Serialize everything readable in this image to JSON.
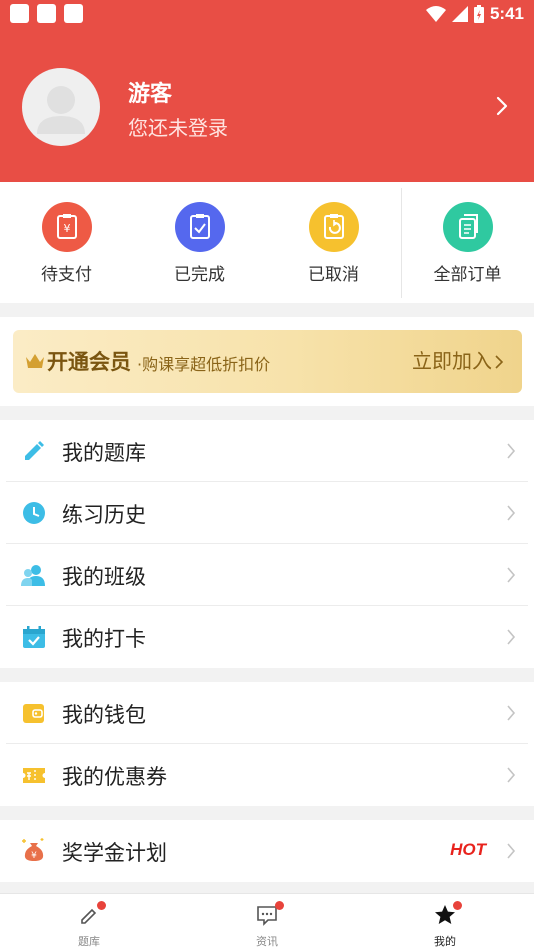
{
  "status_bar": {
    "time": "5:41"
  },
  "profile": {
    "name": "游客",
    "subtitle": "您还未登录"
  },
  "orders": [
    {
      "label": "待支付",
      "icon": "payment-icon",
      "color": "#ee5a45"
    },
    {
      "label": "已完成",
      "icon": "completed-icon",
      "color": "#5568ee"
    },
    {
      "label": "已取消",
      "icon": "cancelled-icon",
      "color": "#f6c12e"
    },
    {
      "label": "全部订单",
      "icon": "all-orders-icon",
      "color": "#2fc9a0"
    }
  ],
  "vip": {
    "title": "开通会员",
    "subtitle": "·购课享超低折扣价",
    "cta": "立即加入"
  },
  "menu_group_1": [
    {
      "label": "我的题库",
      "icon": "pencil-icon"
    },
    {
      "label": "练习历史",
      "icon": "clock-icon"
    },
    {
      "label": "我的班级",
      "icon": "users-icon"
    },
    {
      "label": "我的打卡",
      "icon": "calendar-check-icon"
    }
  ],
  "menu_group_2": [
    {
      "label": "我的钱包",
      "icon": "wallet-icon"
    },
    {
      "label": "我的优惠券",
      "icon": "coupon-icon"
    }
  ],
  "menu_group_3": [
    {
      "label": "奖学金计划",
      "icon": "money-bag-icon",
      "badge": "HOT"
    }
  ],
  "tabbar": [
    {
      "label": "题库",
      "icon": "edit-icon",
      "active": false
    },
    {
      "label": "资讯",
      "icon": "message-icon",
      "active": false
    },
    {
      "label": "我的",
      "icon": "star-icon",
      "active": true
    }
  ],
  "colors": {
    "header": "#e84e45",
    "hot": "#e8231d",
    "accent_dot": "#e8433b"
  }
}
